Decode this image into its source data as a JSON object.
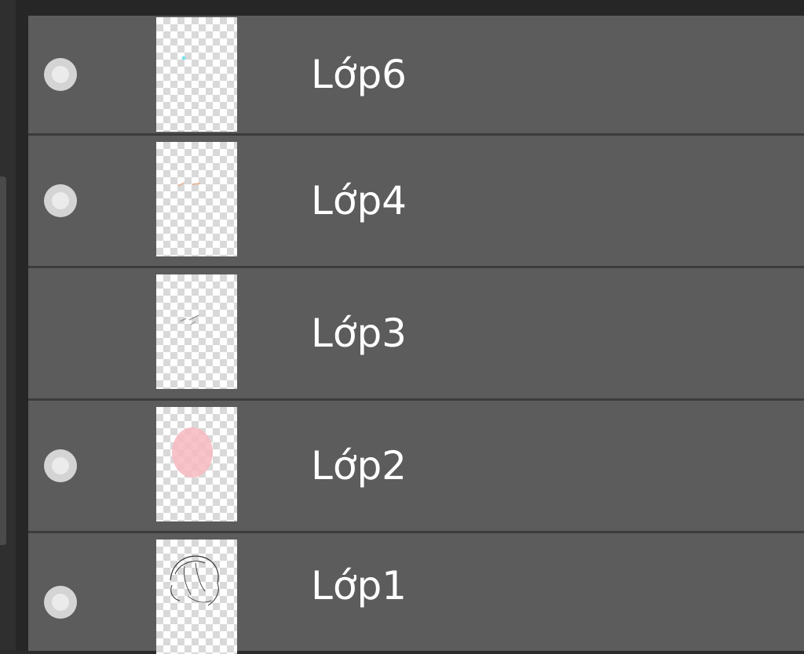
{
  "layers_panel": {
    "layers": [
      {
        "name": "Lớp6",
        "visible": true,
        "thumbnail": "cyan-dot"
      },
      {
        "name": "Lớp4",
        "visible": true,
        "thumbnail": "peach-strokes"
      },
      {
        "name": "Lớp3",
        "visible": false,
        "thumbnail": "gray-strokes"
      },
      {
        "name": "Lớp2",
        "visible": true,
        "thumbnail": "pink-blob"
      },
      {
        "name": "Lớp1",
        "visible": true,
        "thumbnail": "hair-sketch"
      }
    ]
  },
  "colors": {
    "row_bg": "#5c5c5c",
    "separator": "#3c3c3c",
    "eye": "#d4d4d4",
    "text": "#ffffff"
  }
}
